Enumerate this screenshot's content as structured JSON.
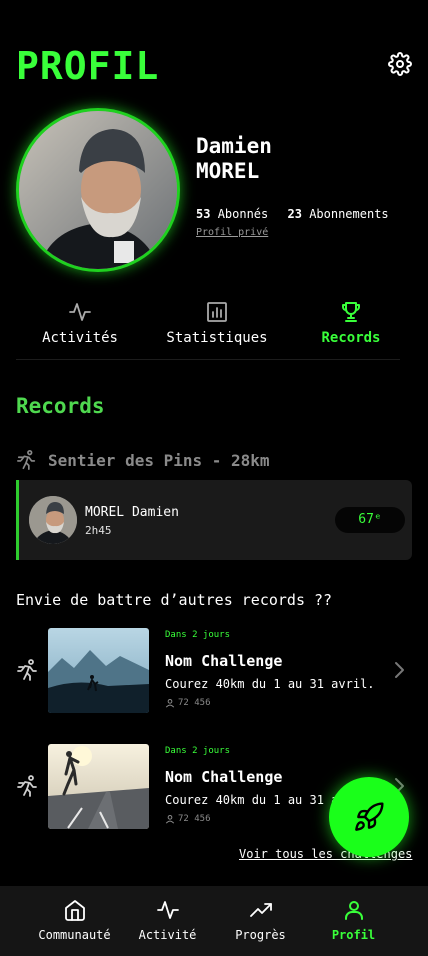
{
  "header": {
    "title": "PROFIL",
    "settings_icon": "gear-icon"
  },
  "profile": {
    "first_name": "Damien",
    "last_name": "MOREL",
    "followers_count": "53",
    "followers_label": "Abonnés",
    "following_count": "23",
    "following_label": "Abonnements",
    "private_label": "Profil privé"
  },
  "tabs": [
    {
      "label": "Activités",
      "icon": "activity-pulse-icon",
      "active": false
    },
    {
      "label": "Statistiques",
      "icon": "bar-chart-icon",
      "active": false
    },
    {
      "label": "Records",
      "icon": "trophy-icon",
      "active": true
    }
  ],
  "records": {
    "heading": "Records",
    "trail_name": "Sentier des Pins - 28km",
    "entry": {
      "name": "MOREL Damien",
      "time": "2h45",
      "rank": "67ᵉ"
    }
  },
  "challenges": {
    "heading": "Envie de battre d’autres records ??",
    "items": [
      {
        "when": "Dans 2 jours",
        "name": "Nom Challenge",
        "description": "Courez 40km du 1 au 31 avril.",
        "participants": "72 456"
      },
      {
        "when": "Dans 2 jours",
        "name": "Nom Challenge",
        "description": "Courez 40km du 1 au 31 avril.",
        "participants": "72 456"
      }
    ],
    "see_all": "Voir tous les challenges"
  },
  "colors": {
    "accent": "#39ff3a",
    "background": "#000000",
    "card": "#1a1a1a",
    "nav": "#151515"
  },
  "bottom_nav": [
    {
      "label": "Communauté",
      "icon": "home-icon",
      "active": false
    },
    {
      "label": "Activité",
      "icon": "activity-pulse-icon",
      "active": false
    },
    {
      "label": "Progrès",
      "icon": "trending-up-icon",
      "active": false
    },
    {
      "label": "Profil",
      "icon": "user-icon",
      "active": true
    }
  ]
}
